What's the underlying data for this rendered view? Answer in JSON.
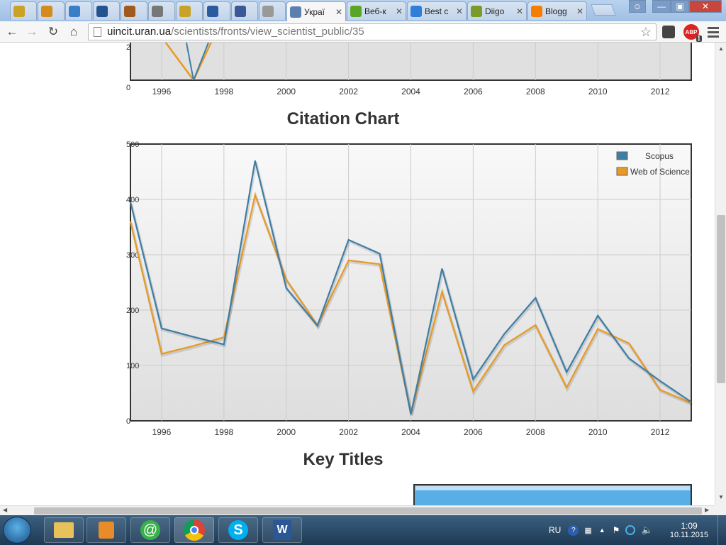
{
  "browser": {
    "tabs": [
      {
        "label": "",
        "icon": "k-icon",
        "color": "#c9a227"
      },
      {
        "label": "",
        "icon": "circle-icon",
        "color": "#d48a1c"
      },
      {
        "label": "",
        "icon": "pen-icon",
        "color": "#3a7dc9"
      },
      {
        "label": "",
        "icon": "target-icon",
        "color": "#24548f"
      },
      {
        "label": "",
        "icon": "box-icon",
        "color": "#a05a1e"
      },
      {
        "label": "",
        "icon": "speaker-icon",
        "color": "#777777"
      },
      {
        "label": "",
        "icon": "k-icon",
        "color": "#c9a227"
      },
      {
        "label": "",
        "icon": "person-icon",
        "color": "#2d5a9e"
      },
      {
        "label": "",
        "icon": "facebook-icon",
        "color": "#3b5998"
      },
      {
        "label": "",
        "icon": "page-icon",
        "color": "#999999"
      },
      {
        "label": "Украї",
        "icon": "globe-icon",
        "color": "#5b7fae",
        "active": true
      },
      {
        "label": "Веб-к",
        "icon": "evernote-icon",
        "color": "#5ba525"
      },
      {
        "label": "Best c",
        "icon": "d-icon",
        "color": "#2f7fd8"
      },
      {
        "label": "Diigo",
        "icon": "diigo-icon",
        "color": "#7a9a2a"
      },
      {
        "label": "Blogg",
        "icon": "blogger-icon",
        "color": "#f57d00"
      }
    ],
    "url_host": "uincit.uran.ua",
    "url_path": "/scientists/fronts/view_scientist_public/35",
    "abp_label": "ABP",
    "abp_count": "1"
  },
  "page": {
    "top_chart_x_labels": [
      "1996",
      "1998",
      "2000",
      "2002",
      "2004",
      "2006",
      "2008",
      "2010",
      "2012"
    ],
    "top_chart_y_labels": [
      "2",
      "0"
    ],
    "citation_title": "Citation Chart",
    "key_titles": "Key Titles"
  },
  "chart_data": {
    "type": "line",
    "title": "Citation Chart",
    "x": [
      1995,
      1996,
      1997,
      1998,
      1999,
      2000,
      2001,
      2002,
      2003,
      2004,
      2005,
      2006,
      2007,
      2008,
      2009,
      2010,
      2011,
      2012,
      2013
    ],
    "x_tick_labels": [
      "1996",
      "1998",
      "2000",
      "2002",
      "2004",
      "2006",
      "2008",
      "2010",
      "2012"
    ],
    "y_tick_labels": [
      "500",
      "400",
      "300",
      "200",
      "100",
      "0"
    ],
    "ylim": [
      0,
      500
    ],
    "xlim": [
      1995,
      2013
    ],
    "series": [
      {
        "name": "Scopus",
        "color": "#3e7ea6",
        "values": [
          395,
          167,
          152,
          138,
          470,
          240,
          172,
          327,
          302,
          12,
          275,
          75,
          157,
          222,
          88,
          190,
          113,
          72,
          34
        ]
      },
      {
        "name": "Web of Science",
        "color": "#e89a24",
        "values": [
          360,
          121,
          135,
          151,
          408,
          255,
          173,
          290,
          283,
          14,
          233,
          53,
          137,
          173,
          60,
          166,
          140,
          56,
          32
        ]
      }
    ],
    "legend_position": "top-right",
    "grid": true
  },
  "taskbar": {
    "lang": "RU",
    "time": "1:09",
    "date": "10.11.2015"
  }
}
